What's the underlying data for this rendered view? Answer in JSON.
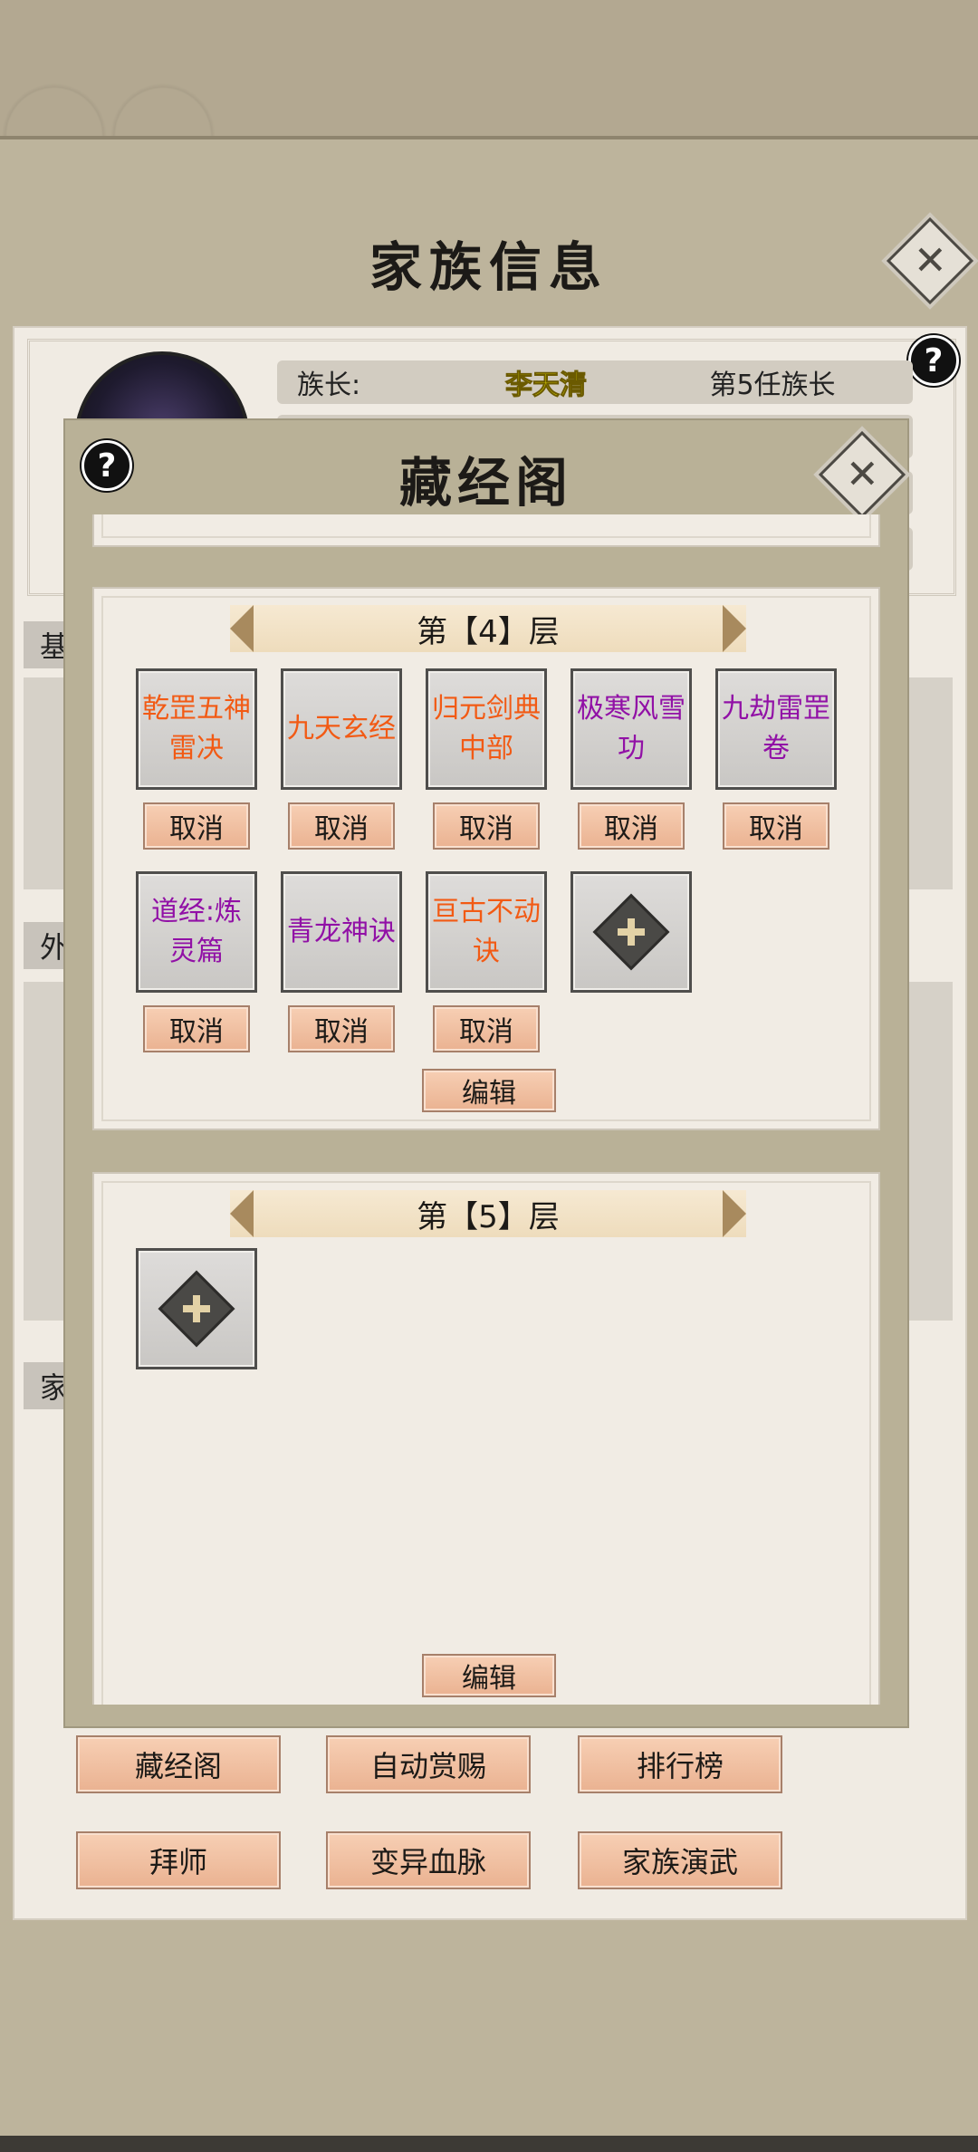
{
  "main": {
    "title": "家族信息",
    "close_icon": "close-icon",
    "help_icon": "help-icon"
  },
  "family": {
    "leader_label": "族长:",
    "leader_name": "李天清",
    "leader_generation": "第5任族长",
    "side_tags": [
      "基",
      "外",
      "家"
    ]
  },
  "nav": {
    "buttons": [
      "藏经阁",
      "自动赏赐",
      "排行榜",
      "拜师",
      "变异血脉",
      "家族演武"
    ]
  },
  "modal": {
    "title": "藏经阁",
    "help_icon": "help-icon",
    "close_icon": "close-icon",
    "partial_edit_label": "编辑",
    "floors": [
      {
        "title": "第【4】层",
        "slots": [
          {
            "name": "乾罡五神雷决",
            "rarity_color": "#f25a14"
          },
          {
            "name": "九天玄经",
            "rarity_color": "#f25a14"
          },
          {
            "name": "归元剑典中部",
            "rarity_color": "#f25a14"
          },
          {
            "name": "极寒风雪功",
            "rarity_color": "#9110a6"
          },
          {
            "name": "九劫雷罡卷",
            "rarity_color": "#9110a6"
          },
          {
            "name": "道经:炼灵篇",
            "rarity_color": "#9110a6"
          },
          {
            "name": "青龙神诀",
            "rarity_color": "#9110a6"
          },
          {
            "name": "亘古不动诀",
            "rarity_color": "#f25a14"
          }
        ],
        "cancel_label": "取消",
        "add_icon": "add-plus-icon",
        "edit_label": "编辑"
      },
      {
        "title": "第【5】层",
        "slots": [],
        "add_icon": "add-plus-icon",
        "edit_label": "编辑"
      }
    ]
  },
  "colors": {
    "orange_rarity": "#f25a14",
    "purple_rarity": "#9110a6",
    "leader_name": "#f6f000"
  }
}
